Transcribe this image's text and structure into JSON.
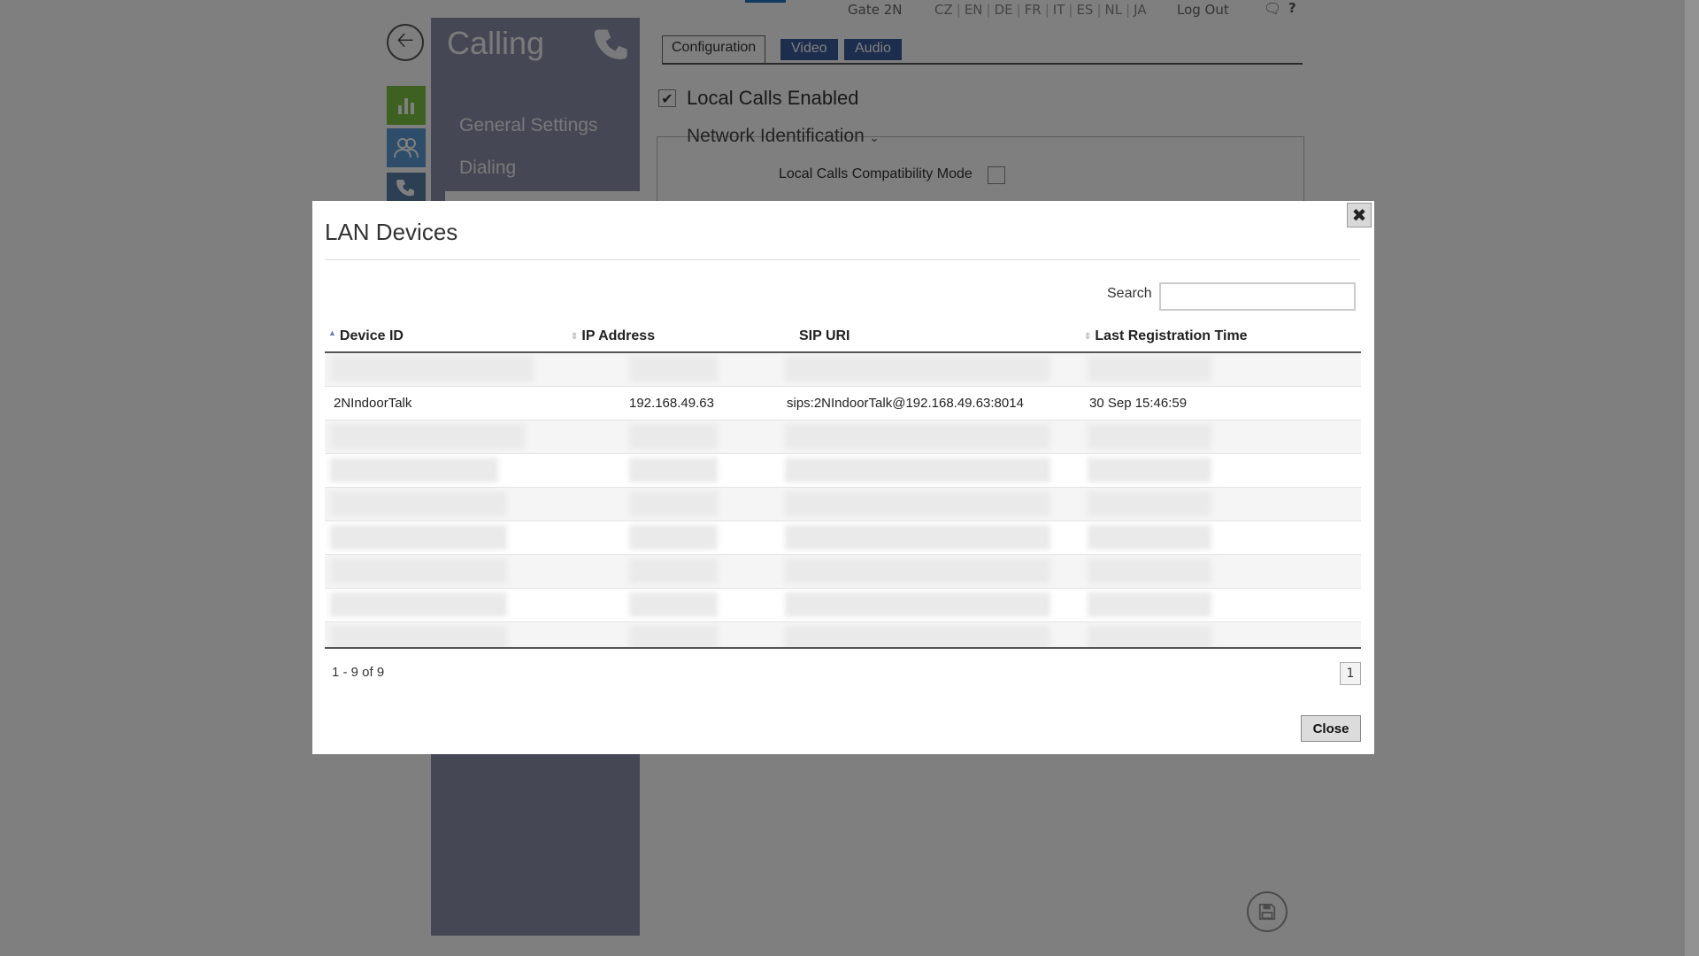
{
  "topnav": {
    "device": "Gate 2N",
    "languages": [
      "CZ",
      "EN",
      "DE",
      "FR",
      "IT",
      "ES",
      "NL",
      "JA"
    ],
    "logout": "Log Out",
    "help": "?"
  },
  "sidebar": {
    "title": "Calling",
    "items": [
      {
        "label": "General Settings"
      },
      {
        "label": "Dialing"
      }
    ]
  },
  "tabs": [
    {
      "label": "Configuration",
      "active": true
    },
    {
      "label": "Video",
      "active": false
    },
    {
      "label": "Audio",
      "active": false
    }
  ],
  "config": {
    "local_calls_enabled_label": "Local Calls Enabled",
    "local_calls_enabled": true,
    "network_identification": "Network Identification",
    "compat_mode_label": "Local Calls Compatibility Mode"
  },
  "modal": {
    "title": "LAN Devices",
    "search_label": "Search",
    "search_value": "",
    "columns": [
      "Device ID",
      "IP Address",
      "SIP URI",
      "Last Registration Time"
    ],
    "rows": [
      {
        "device_id": "2NIndoorTalk",
        "ip": "192.168.49.63",
        "sip_uri": "sips:2NIndoorTalk@192.168.49.63:8014",
        "last_reg": "30 Sep 15:46:59"
      }
    ],
    "range_text": "1 - 9 of 9",
    "page": "1",
    "close_label": "Close"
  },
  "colors": {
    "sidebar_panel": "#8a90a8",
    "tab_active_blue": "#3a5a9a",
    "status_icon": "#7dc142",
    "directory_icon": "#5b9bd5"
  }
}
